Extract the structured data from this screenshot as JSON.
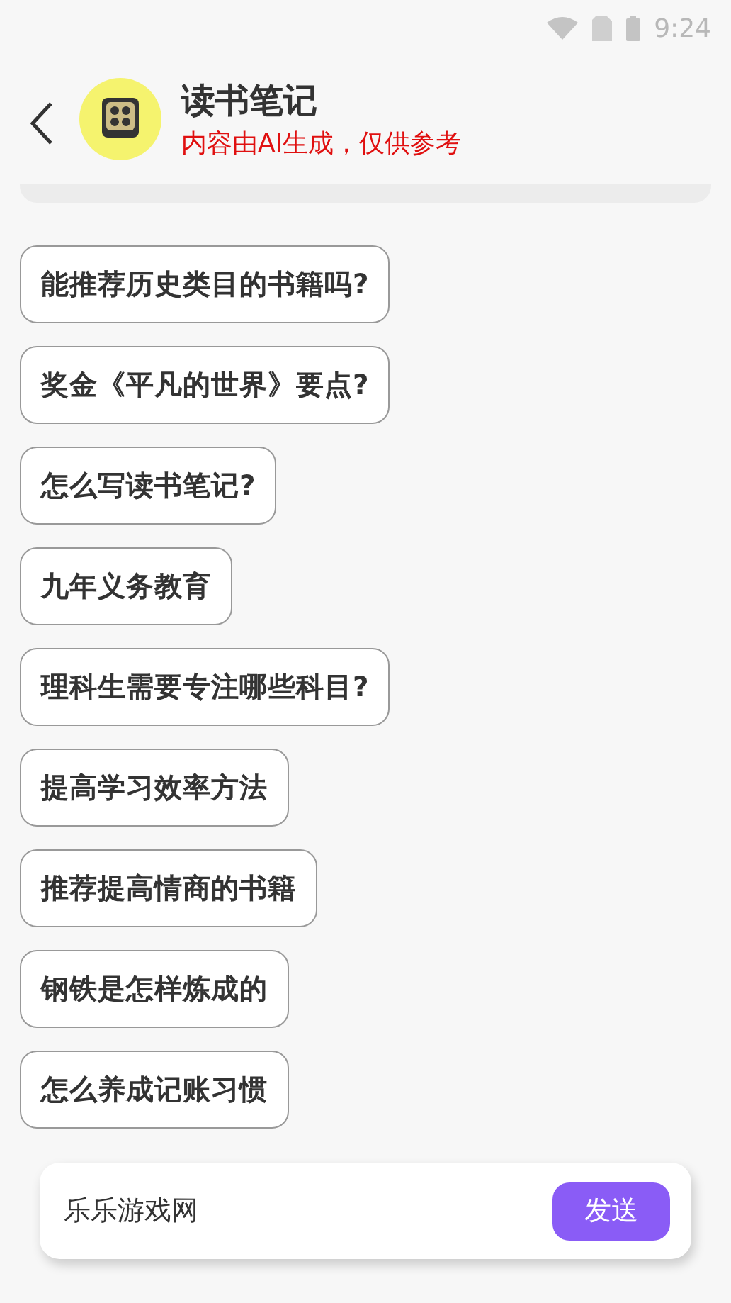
{
  "status_bar": {
    "time": "9:24"
  },
  "header": {
    "title": "读书笔记",
    "subtitle": "内容由AI生成，仅供参考"
  },
  "suggestions": [
    "能推荐历史类目的书籍吗?",
    "奖金《平凡的世界》要点?",
    "怎么写读书笔记?",
    "九年义务教育",
    "理科生需要专注哪些科目?",
    "提高学习效率方法",
    "推荐提高情商的书籍",
    "钢铁是怎样炼成的",
    "怎么养成记账习惯"
  ],
  "composer": {
    "value": "乐乐游戏网",
    "send": "发送"
  }
}
